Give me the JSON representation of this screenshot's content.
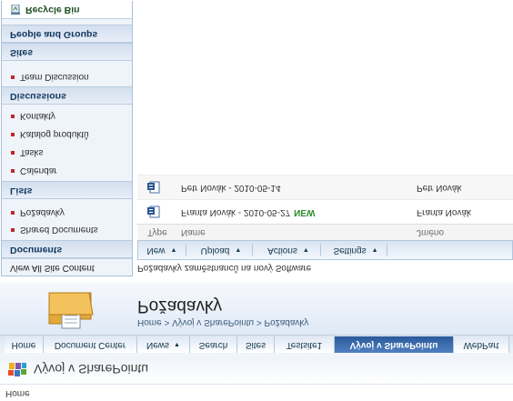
{
  "site": {
    "crumb_home": "Home",
    "title": "Vývoj v SharePointu"
  },
  "topnav": {
    "tabs": [
      {
        "label": "Home"
      },
      {
        "label": "Document Center"
      },
      {
        "label": "News"
      },
      {
        "label": "Search"
      },
      {
        "label": "Sites"
      },
      {
        "label": "Testsite1"
      },
      {
        "label": "Vývoj v SharePointu"
      },
      {
        "label": "WebPart"
      }
    ]
  },
  "page": {
    "breadcrumb": "Home > Vývoj v SharePointu > Požadavky",
    "title": "Požadavky",
    "description": "Požadavky zaměstnanců na nový Software"
  },
  "quick_launch": {
    "view_all": "View All Site Content",
    "documents_heading": "Documents",
    "documents_items": [
      "Shared Documents",
      "Požadavky"
    ],
    "lists_heading": "Lists",
    "lists_items": [
      "Calendar",
      "Tasks",
      "Katalog produktů",
      "Kontakty"
    ],
    "discussions_heading": "Discussions",
    "discussions_items": [
      "Team Discussion"
    ],
    "sites_heading": "Sites",
    "people_heading": "People and Groups",
    "recycle_bin": "Recycle Bin"
  },
  "toolbar": {
    "new": "New",
    "upload": "Upload",
    "actions": "Actions",
    "settings": "Settings"
  },
  "list": {
    "columns": {
      "type": "Type",
      "name": "Name",
      "creator": "Jméno"
    },
    "new_badge": "NEW",
    "rows": [
      {
        "name": "Franta Novák - 2010-05-27",
        "is_new": true,
        "creator": "Franta Novák"
      },
      {
        "name": "Petr Novák - 2010-05-14",
        "is_new": false,
        "creator": "Petr Novák"
      }
    ]
  },
  "colors": {
    "accent_tab": "#2a5a9b",
    "bullet": "#c0282b",
    "new_badge": "#2e8b2e"
  }
}
